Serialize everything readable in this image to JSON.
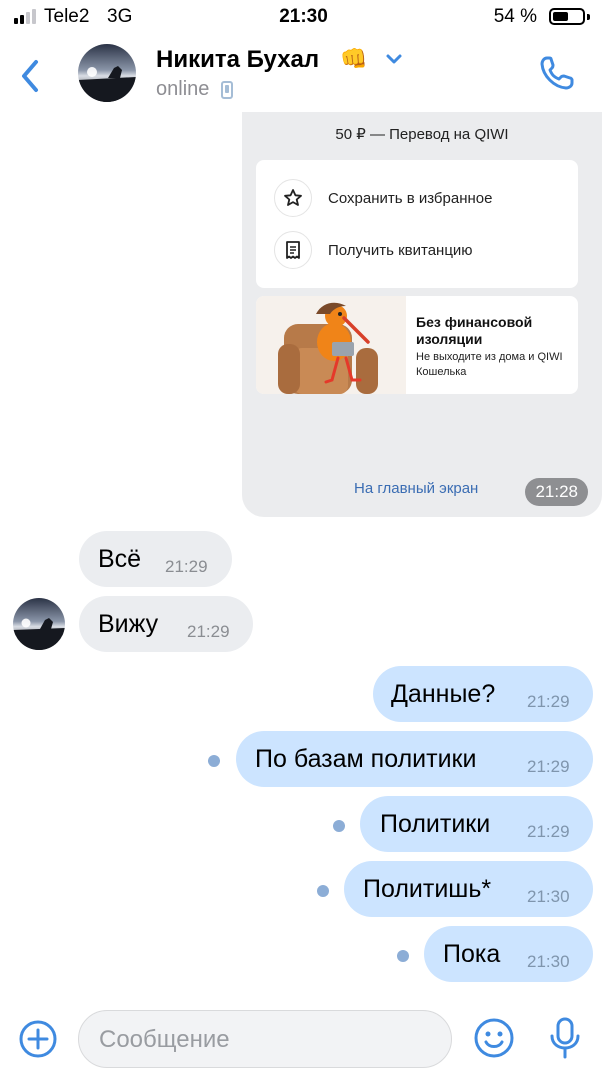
{
  "status_bar": {
    "carrier": "Tele2",
    "network": "3G",
    "time": "21:30",
    "battery_percent": "54 %",
    "battery_level": 0.54,
    "signal_bars": 2
  },
  "header": {
    "contact_name": "Никита Бухал",
    "contact_emoji": "👊",
    "presence": "online",
    "icons": [
      "back-icon",
      "chevron-down-icon",
      "phone-icon",
      "mobile-device-icon"
    ]
  },
  "card_message": {
    "title": "50 ₽ — Перевод на QIWI",
    "actions": [
      {
        "label": "Сохранить в избранное",
        "icon": "star-icon"
      },
      {
        "label": "Получить квитанцию",
        "icon": "receipt-icon"
      }
    ],
    "promo_title": "Без финансовой изоляции",
    "promo_text": "Не выходите из дома и QIWI Кошелька",
    "link": "На главный экран",
    "time": "21:28"
  },
  "messages": [
    {
      "direction": "in",
      "text": "Всё",
      "time": "21:29"
    },
    {
      "direction": "in",
      "text": "Вижу",
      "time": "21:29"
    },
    {
      "direction": "out",
      "text": "Данные?",
      "time": "21:29",
      "unread": false
    },
    {
      "direction": "out",
      "text": "По базам политики",
      "time": "21:29",
      "unread": true
    },
    {
      "direction": "out",
      "text": "Политики",
      "time": "21:29",
      "unread": true
    },
    {
      "direction": "out",
      "text": "Политишь*",
      "time": "21:30",
      "unread": true
    },
    {
      "direction": "out",
      "text": "Пока",
      "time": "21:30",
      "unread": true
    }
  ],
  "composer": {
    "placeholder": "Сообщение",
    "icons": [
      "plus-icon",
      "emoji-icon",
      "microphone-icon"
    ]
  },
  "colors": {
    "accent": "#3f8ae0",
    "outgoing_bubble": "#cce4ff",
    "incoming_bubble": "#ebedf0",
    "unread_dot": "#8cadd6",
    "link": "#3b6db3"
  }
}
